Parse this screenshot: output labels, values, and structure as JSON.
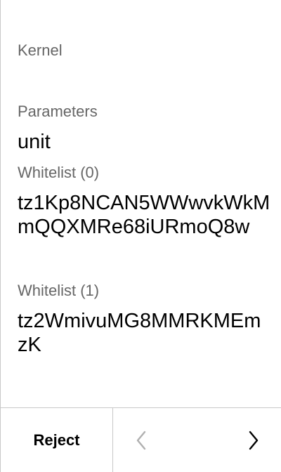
{
  "kernel": {
    "label": "Kernel"
  },
  "fields": {
    "parameters": {
      "label": "Parameters",
      "value": "unit"
    },
    "whitelist_0": {
      "label": "Whitelist (0)",
      "value": "tz1Kp8NCAN5WWwvkWkMmQQXMRe68iURmoQ8w"
    },
    "whitelist_1": {
      "label": "Whitelist (1)",
      "value": "tz2WmivuMG8MMRKMEmzK"
    }
  },
  "footer": {
    "reject_label": "Reject",
    "prev_icon": "chevron-left-icon",
    "next_icon": "chevron-right-icon"
  },
  "colors": {
    "label": "#666666",
    "value": "#000000",
    "border": "#c8c8c8",
    "prev_disabled": "#b0b0b0",
    "next_enabled": "#000000"
  }
}
